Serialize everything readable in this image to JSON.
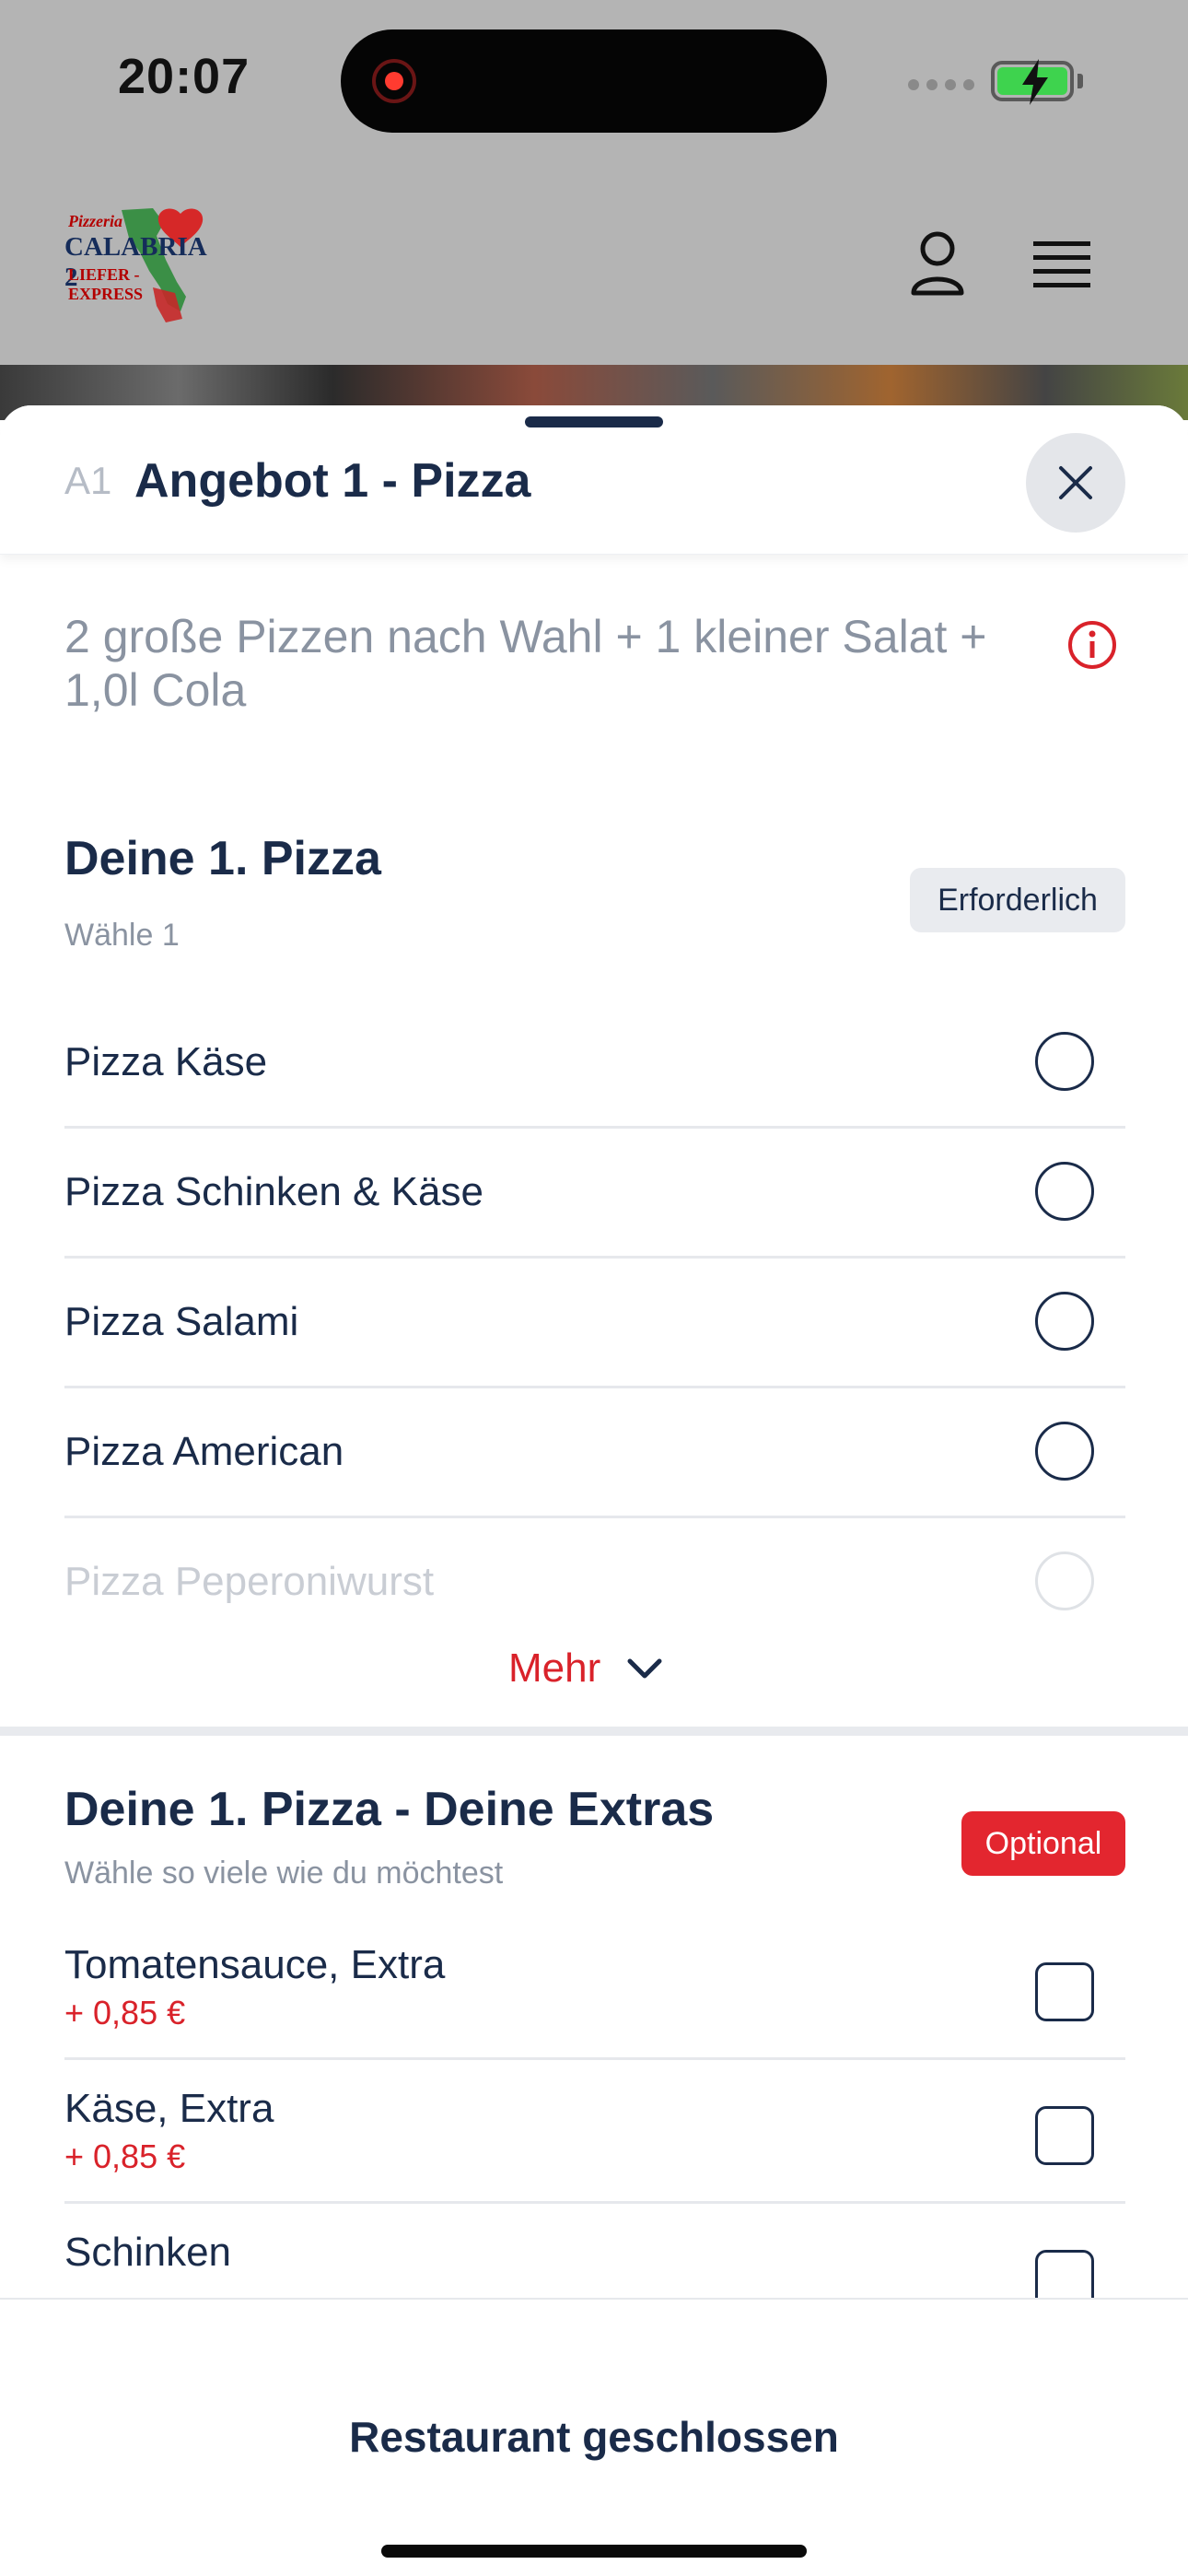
{
  "status_bar": {
    "time": "20:07"
  },
  "restaurant": {
    "logo_line1": "Pizzeria",
    "logo_line2": "CALABRIA 2",
    "logo_line3": "LIEFER - EXPRESS"
  },
  "item": {
    "code": "A1",
    "title": "Angebot 1 - Pizza",
    "description": "2 große Pizzen nach Wahl + 1 kleiner Salat + 1,0l Cola"
  },
  "group1": {
    "title": "Deine 1. Pizza",
    "subtitle": "Wähle 1",
    "badge": "Erforderlich",
    "options": [
      {
        "label": "Pizza Käse"
      },
      {
        "label": "Pizza Schinken & Käse"
      },
      {
        "label": "Pizza Salami"
      },
      {
        "label": "Pizza American"
      },
      {
        "label": "Pizza Peperoniwurst"
      }
    ],
    "more_label": "Mehr"
  },
  "group2": {
    "title": "Deine 1. Pizza - Deine Extras",
    "subtitle": "Wähle so viele wie du möchtest",
    "badge": "Optional",
    "options": [
      {
        "label": "Tomatensauce, Extra",
        "price": "+ 0,85 €"
      },
      {
        "label": "Käse, Extra",
        "price": "+ 0,85 €"
      },
      {
        "label": "Schinken",
        "price": ""
      }
    ]
  },
  "footer": {
    "status": "Restaurant geschlossen"
  },
  "colors": {
    "accent": "#d9222a",
    "text": "#1a2b49",
    "muted": "#8a93a1"
  }
}
